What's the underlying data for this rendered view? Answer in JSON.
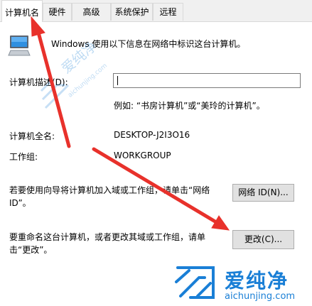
{
  "tabs": [
    "计算机名",
    "硬件",
    "高级",
    "系统保护",
    "远程"
  ],
  "intro_text": "Windows 使用以下信息在网络中标识这台计算机。",
  "description": {
    "label": "计算机描述(D):",
    "value": "",
    "example": "例如: “书房计算机”或“美玲的计算机”。"
  },
  "full_name": {
    "label": "计算机全名:",
    "value": "DESKTOP-J2I3O16"
  },
  "workgroup": {
    "label": "工作组:",
    "value": "WORKGROUP"
  },
  "network_id": {
    "text": "若要使用向导将计算机加入域或工作组，请单击“网络 ID”。",
    "button_label": "网络 ID(N)..."
  },
  "rename": {
    "text": "要重命名这台计算机，或者更改其域或工作组，请单击“更改”。",
    "button_label": "更改(C)..."
  },
  "watermark": {
    "main": "爱纯净",
    "sub": "aichunjing.com"
  },
  "colors": {
    "arrow": "#e8312b",
    "watermark": "#1a7fd6"
  }
}
